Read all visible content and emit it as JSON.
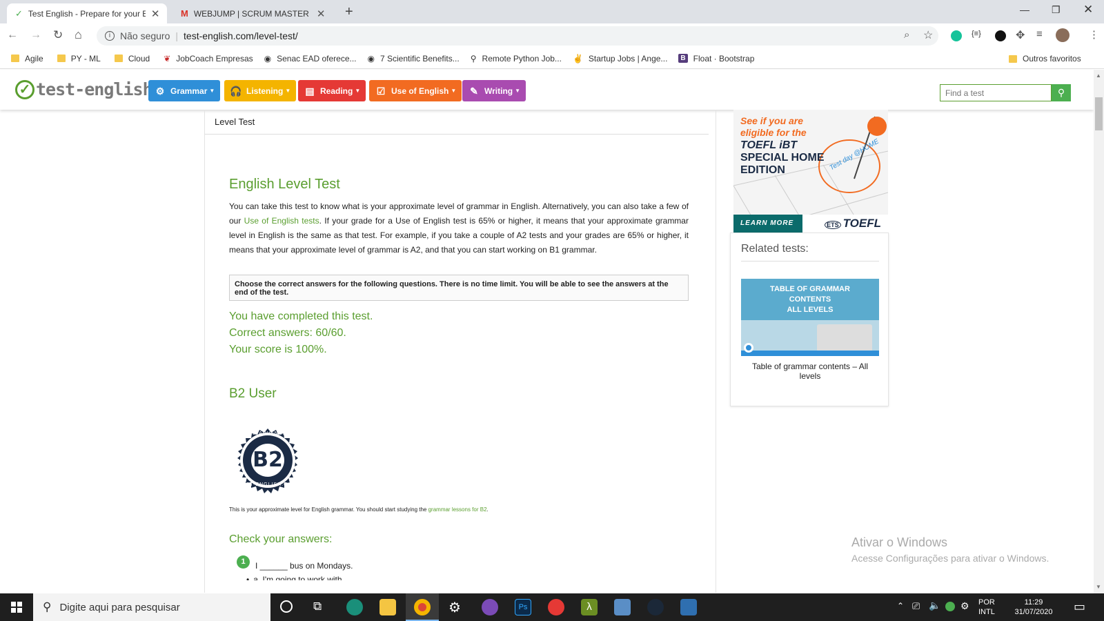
{
  "browser": {
    "tabs": [
      {
        "title": "Test English - Prepare for your En",
        "active": true
      },
      {
        "title": "WEBJUMP | SCRUM MASTER - PF",
        "active": false
      }
    ],
    "security_label": "Não seguro",
    "url": "test-english.com/level-test/",
    "bookmarks": [
      "Agile",
      "PY - ML",
      "Cloud",
      "JobCoach Empresas",
      "Senac EAD oferece...",
      "7 Scientific Benefits...",
      "Remote Python Job...",
      "Startup Jobs | Ange...",
      "Float · Bootstrap"
    ],
    "other_bookmarks": "Outros favoritos"
  },
  "site": {
    "logo_text": "test-english",
    "menu": [
      {
        "label": "Grammar",
        "color": "#2f8fd8",
        "icon": "gear-icon"
      },
      {
        "label": "Listening",
        "color": "#f4b400",
        "icon": "headphones-icon"
      },
      {
        "label": "Reading",
        "color": "#e53935",
        "icon": "document-icon"
      },
      {
        "label": "Use of English",
        "color": "#f26b21",
        "icon": "checklist-icon"
      },
      {
        "label": "Writing",
        "color": "#a94bb0",
        "icon": "pen-icon"
      }
    ],
    "search_placeholder": "Find a test"
  },
  "main": {
    "breadcrumb": "Level Test",
    "heading": "English Level Test",
    "intro_before_link": "You can take this test to know what is your approximate level of grammar in English. Alternatively, you can also take a few of our ",
    "intro_link": "Use of English tests",
    "intro_after_link": ". If your grade for a Use of English test is 65% or higher, it means that your approximate grammar level in English is the same as that test. For example, if you take a couple of A2 tests and your grades are 65% or higher, it means that your approximate level of grammar is A2, and that you can start working on B1 grammar.",
    "instructions": "Choose the correct answers for the following questions. There is no time limit. You will be able to see the answers at the end of the test.",
    "result_completed": "You have completed this test.",
    "result_correct": "Correct answers: 60/60.",
    "result_score": "Your score is 100%.",
    "level_heading": "B2 User",
    "badge_level": "B2",
    "badge_top_text": "PRE-ADVANCED",
    "badge_bottom_text": "TEST-ENGLISH.COM",
    "level_note_before": "This is your approximate level for English grammar. You should start studying the ",
    "level_note_link": "grammar lessons for B2",
    "level_note_after": ".",
    "check_heading": "Check your answers:",
    "question_number": "1",
    "question_text": "I ______ bus on Mondays.",
    "option_partial": "a. I'm going to work with"
  },
  "ad": {
    "line1": "See if you are",
    "line2": "eligible for the",
    "line3": "TOEFL iBT",
    "line4": "SPECIAL HOME",
    "line5": "EDITION",
    "stamp": "Test day @HOME",
    "learn_more": "LEARN MORE",
    "brand": "TOEFL",
    "brand_prefix": "ETS"
  },
  "related": {
    "heading": "Related tests:",
    "card_title_lines": [
      "TABLE OF GRAMMAR",
      "CONTENTS",
      "ALL LEVELS"
    ],
    "card_caption": "Table of grammar contents – All levels"
  },
  "watermark": {
    "title": "Ativar o Windows",
    "subtitle": "Acesse Configurações para ativar o Windows."
  },
  "taskbar": {
    "search_placeholder": "Digite aqui para pesquisar",
    "lang": "POR",
    "layout": "INTL",
    "time": "11:29",
    "date": "31/07/2020"
  }
}
